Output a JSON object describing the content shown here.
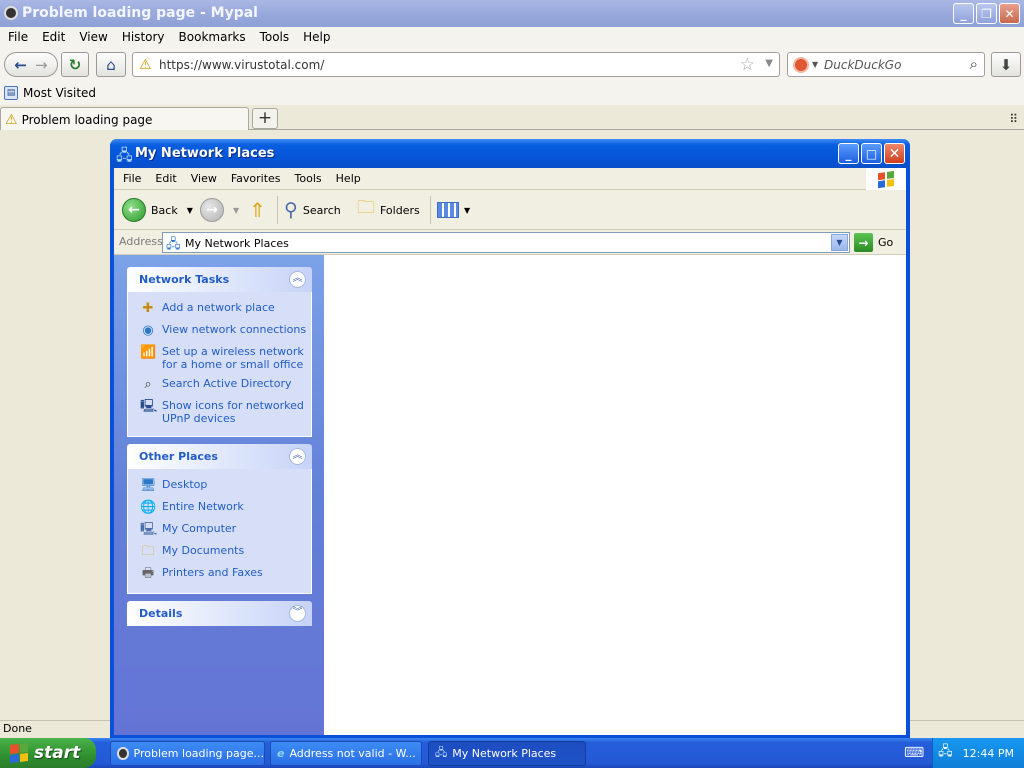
{
  "browser": {
    "title": "Problem loading page - Mypal",
    "menu": [
      "File",
      "Edit",
      "View",
      "History",
      "Bookmarks",
      "Tools",
      "Help"
    ],
    "url": "https://www.virustotal.com/",
    "search_placeholder": "DuckDuckGo",
    "bookmark": "Most Visited",
    "tab_label": "Problem loading page",
    "status": "Done"
  },
  "explorer": {
    "title": "My Network Places",
    "menu": [
      "File",
      "Edit",
      "View",
      "Favorites",
      "Tools",
      "Help"
    ],
    "toolbar": {
      "back": "Back",
      "search": "Search",
      "folders": "Folders"
    },
    "address_label": "Address",
    "address_value": "My Network Places",
    "go": "Go",
    "panels": {
      "network_tasks": {
        "title": "Network Tasks",
        "items": [
          {
            "icon": "add-network-place-icon",
            "label": "Add a network place"
          },
          {
            "icon": "network-connections-icon",
            "label": "View network connections"
          },
          {
            "icon": "wireless-network-icon",
            "label": "Set up a wireless network for a home or small office"
          },
          {
            "icon": "search-directory-icon",
            "label": "Search Active Directory"
          },
          {
            "icon": "upnp-device-icon",
            "label": "Show icons for networked UPnP devices"
          }
        ]
      },
      "other_places": {
        "title": "Other Places",
        "items": [
          {
            "icon": "desktop-icon",
            "label": "Desktop"
          },
          {
            "icon": "entire-network-icon",
            "label": "Entire Network"
          },
          {
            "icon": "my-computer-icon",
            "label": "My Computer"
          },
          {
            "icon": "my-documents-icon",
            "label": "My Documents"
          },
          {
            "icon": "printers-icon",
            "label": "Printers and Faxes"
          }
        ]
      },
      "details": {
        "title": "Details"
      }
    }
  },
  "taskbar": {
    "start": "start",
    "tasks": [
      "Problem loading page...",
      "Address not valid - W...",
      "My Network Places"
    ],
    "clock": "12:44 PM"
  }
}
